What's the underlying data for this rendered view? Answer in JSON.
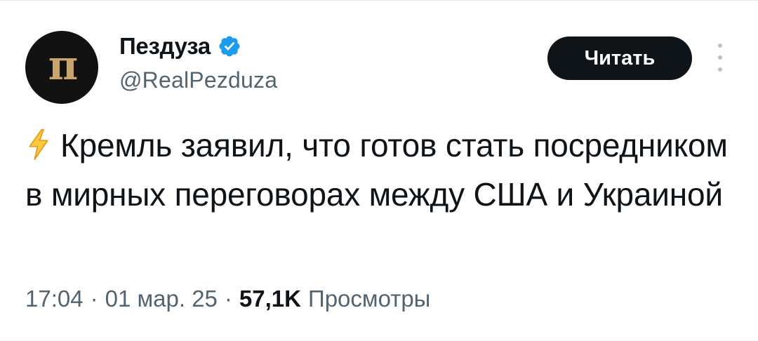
{
  "author": {
    "display_name": "Пездуза",
    "handle": "@RealPezduza",
    "verified": true,
    "avatar_glyph": "п",
    "avatar_bg": "#121212",
    "avatar_fg": "#c9a66b"
  },
  "actions": {
    "follow_label": "Читать",
    "more_icon": "more-vertical-icon"
  },
  "tweet": {
    "emoji_icon": "lightning-icon",
    "text": "Кремль заявил, что готов стать посредником в мирных переговорах между США и Украиной"
  },
  "meta": {
    "time": "17:04",
    "separator": "·",
    "date": "01 мар. 25",
    "views_count": "57,1K",
    "views_label": "Просмотры"
  },
  "colors": {
    "verified_blue": "#1d9bf0",
    "text_primary": "#0f1419",
    "text_secondary": "#536471",
    "button_bg": "#0f1419"
  }
}
